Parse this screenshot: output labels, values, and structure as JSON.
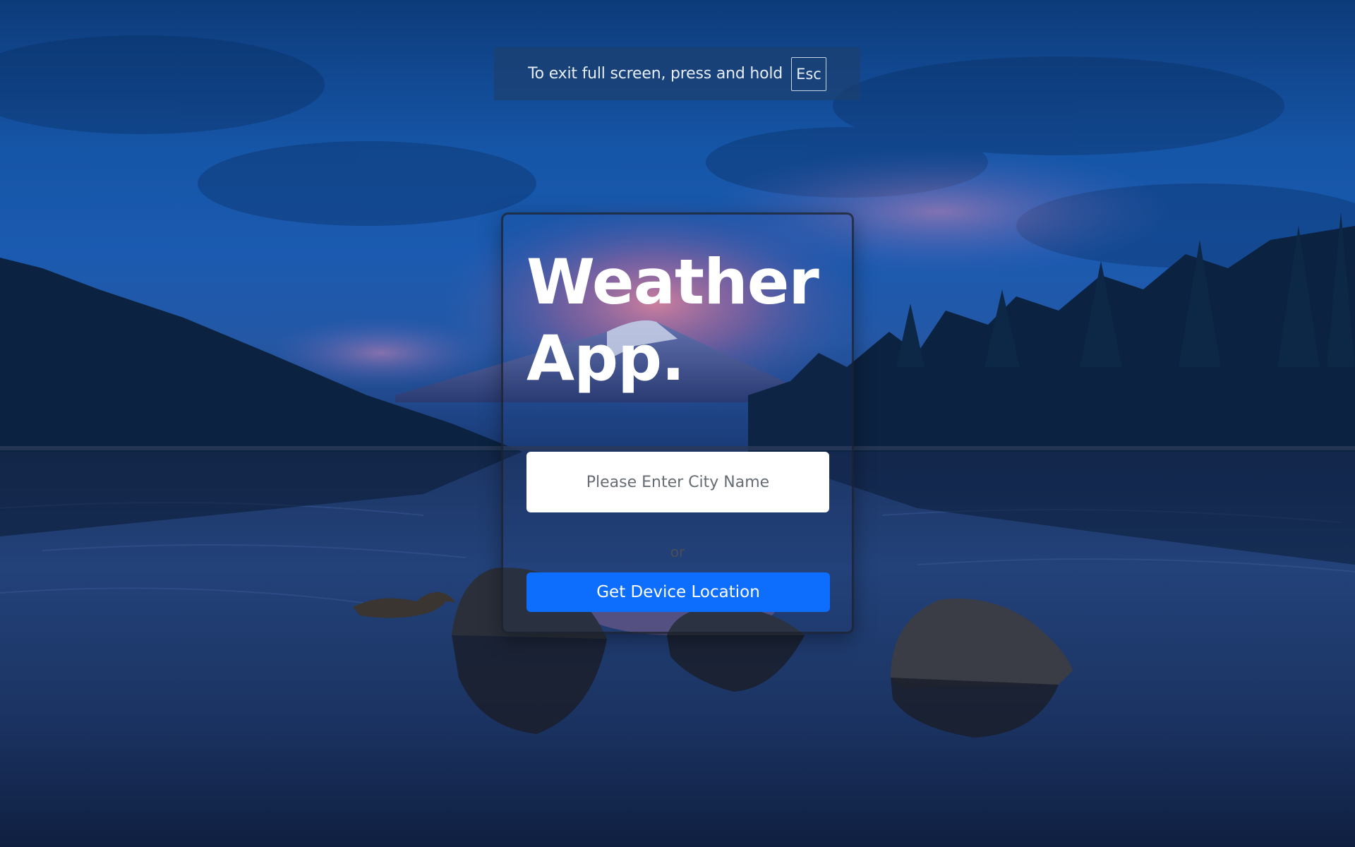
{
  "fullscreen_notice": {
    "message": "To exit full screen, press and hold",
    "key": "Esc"
  },
  "app": {
    "title_line1": "Weather",
    "title_line2": "App.",
    "city_input": {
      "placeholder": "Please Enter City Name",
      "value": ""
    },
    "separator": "or",
    "location_button": "Get Device Location"
  },
  "background": {
    "description_icon": "lake-mountain-sunset-image",
    "accent_color": "#0d6efd"
  }
}
